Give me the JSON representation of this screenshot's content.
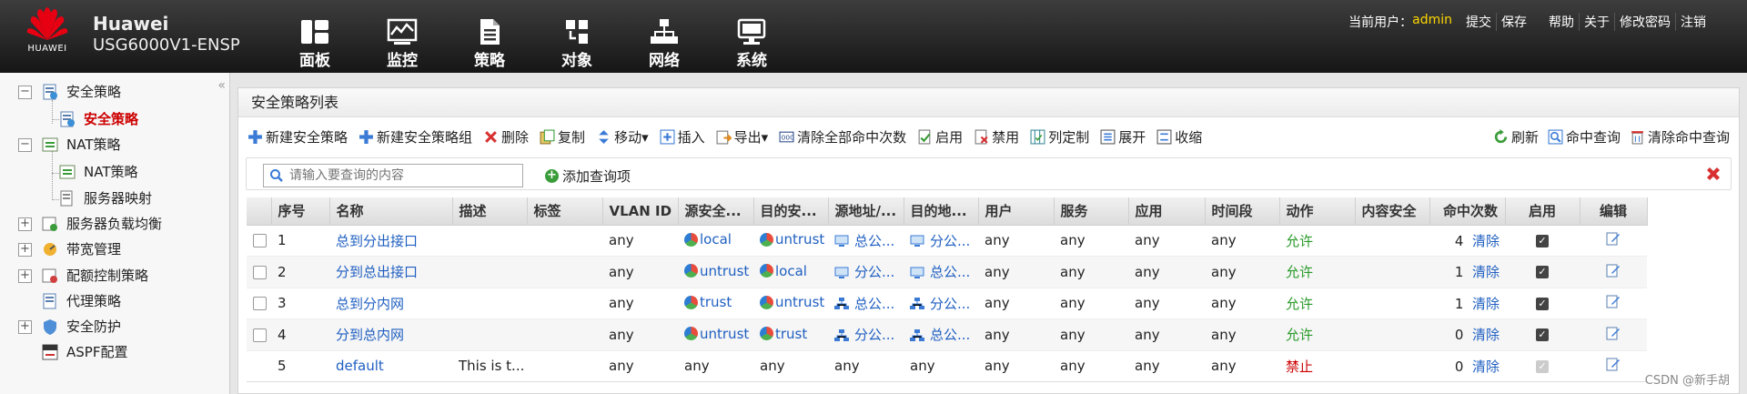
{
  "header": {
    "logo_text": "HUAWEI",
    "brand": "Huawei",
    "model": "USG6000V1-ENSP",
    "nav": [
      {
        "label": "面板",
        "icon": "dashboard-icon"
      },
      {
        "label": "监控",
        "icon": "monitor-icon"
      },
      {
        "label": "策略",
        "icon": "policy-document-icon"
      },
      {
        "label": "对象",
        "icon": "objects-icon"
      },
      {
        "label": "网络",
        "icon": "network-icon"
      },
      {
        "label": "系统",
        "icon": "system-icon"
      }
    ],
    "user_label": "当前用户：",
    "username": "admin",
    "links": [
      "提交",
      "保存",
      "帮助",
      "关于",
      "修改密码",
      "注销"
    ]
  },
  "sidebar": {
    "collapse_glyph": "«",
    "items": [
      {
        "label": "安全策略",
        "toggle": "−"
      },
      {
        "label": "安全策略"
      },
      {
        "label": "NAT策略",
        "toggle": "−"
      },
      {
        "label": "NAT策略"
      },
      {
        "label": "服务器映射"
      },
      {
        "label": "服务器负载均衡",
        "toggle": "+"
      },
      {
        "label": "带宽管理",
        "toggle": "+"
      },
      {
        "label": "配额控制策略",
        "toggle": "+"
      },
      {
        "label": "代理策略"
      },
      {
        "label": "安全防护",
        "toggle": "+"
      },
      {
        "label": "ASPF配置"
      }
    ]
  },
  "panel": {
    "title": "安全策略列表",
    "toolbar": [
      "新建安全策略",
      "新建安全策略组",
      "删除",
      "复制",
      "移动▾",
      "插入",
      "导出▾",
      "清除全部命中次数",
      "启用",
      "禁用",
      "列定制",
      "展开",
      "收缩"
    ],
    "toolbar_right": [
      "刷新",
      "命中查询",
      "清除命中查询"
    ],
    "search_placeholder": "请输入要查询的内容",
    "add_query": "添加查询项"
  },
  "table": {
    "headers": [
      "",
      "序号",
      "名称",
      "描述",
      "标签",
      "VLAN ID",
      "源安全...",
      "目的安...",
      "源地址/...",
      "目的地...",
      "用户",
      "服务",
      "应用",
      "时间段",
      "动作",
      "内容安全",
      "命中次数",
      "启用",
      "编辑"
    ],
    "rows": [
      {
        "seq": "1",
        "name": "总到分出接口",
        "desc": "",
        "tag": "",
        "vlan": "any",
        "src_zone": "local",
        "dst_zone": "untrust",
        "src_addr": "总公...",
        "dst_addr": "分公...",
        "user": "any",
        "service": "any",
        "app": "any",
        "time": "any",
        "action": "允许",
        "content": "",
        "hits": "4",
        "clear": "清除",
        "enabled": true
      },
      {
        "seq": "2",
        "name": "分到总出接口",
        "desc": "",
        "tag": "",
        "vlan": "any",
        "src_zone": "untrust",
        "dst_zone": "local",
        "src_addr": "分公...",
        "dst_addr": "总公...",
        "user": "any",
        "service": "any",
        "app": "any",
        "time": "any",
        "action": "允许",
        "content": "",
        "hits": "1",
        "clear": "清除",
        "enabled": true
      },
      {
        "seq": "3",
        "name": "总到分内网",
        "desc": "",
        "tag": "",
        "vlan": "any",
        "src_zone": "trust",
        "dst_zone": "untrust",
        "src_addr": "总公...",
        "dst_addr": "分公...",
        "user": "any",
        "service": "any",
        "app": "any",
        "time": "any",
        "action": "允许",
        "content": "",
        "hits": "1",
        "clear": "清除",
        "enabled": true
      },
      {
        "seq": "4",
        "name": "分到总内网",
        "desc": "",
        "tag": "",
        "vlan": "any",
        "src_zone": "untrust",
        "dst_zone": "trust",
        "src_addr": "分公...",
        "dst_addr": "总公...",
        "user": "any",
        "service": "any",
        "app": "any",
        "time": "any",
        "action": "允许",
        "content": "",
        "hits": "0",
        "clear": "清除",
        "enabled": true
      },
      {
        "seq": "5",
        "name": "default",
        "desc": "This is t...",
        "tag": "",
        "vlan": "any",
        "src_zone": "any",
        "dst_zone": "any",
        "src_addr": "any",
        "dst_addr": "any",
        "user": "any",
        "service": "any",
        "app": "any",
        "time": "any",
        "action": "禁止",
        "content": "",
        "hits": "0",
        "clear": "清除",
        "enabled": true
      }
    ]
  },
  "watermark": "CSDN @新手胡"
}
